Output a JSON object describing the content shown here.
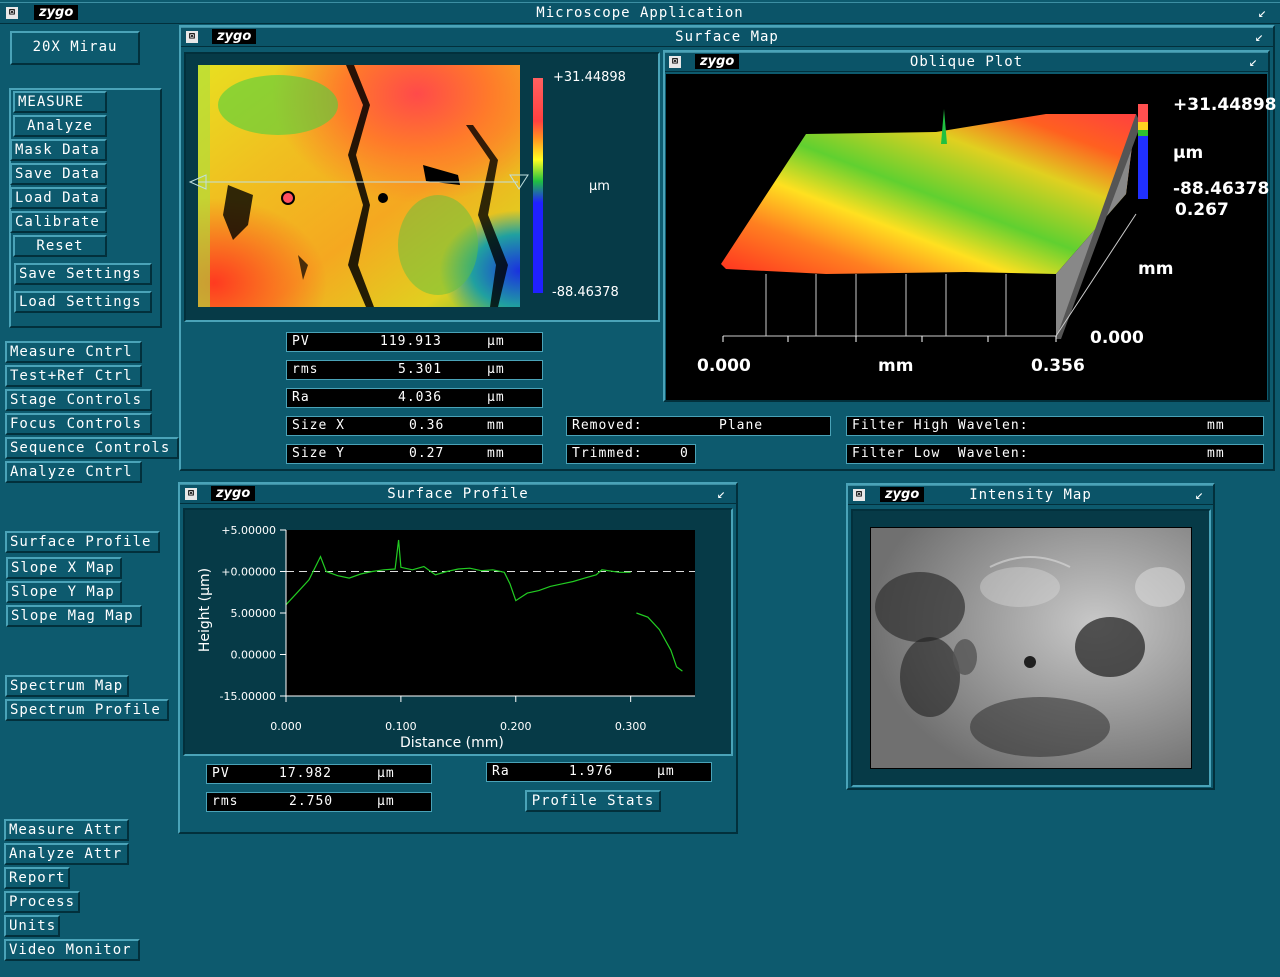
{
  "app": {
    "title": "Microscope  Application",
    "logo": "zygo"
  },
  "objective": "20X  Mirau",
  "left_menu": {
    "measure": "MEASURE",
    "analyze": "Analyze",
    "mask_data": "Mask Data",
    "save_data": "Save Data",
    "load_data": "Load Data",
    "calibrate": "Calibrate",
    "reset": "Reset",
    "save_settings": "Save Settings",
    "load_settings": "Load Settings",
    "measure_cntrl": "Measure Cntrl",
    "test_ref_ctrl": "Test+Ref Ctrl",
    "stage_controls": "Stage Controls",
    "focus_controls": "Focus Controls",
    "sequence_controls": "Sequence Controls",
    "analyze_cntrl": "Analyze Cntrl",
    "surface_profile": "Surface Profile",
    "slope_x_map": "Slope X Map",
    "slope_y_map": "Slope Y Map",
    "slope_mag_map": "Slope Mag Map",
    "spectrum_map": "Spectrum Map",
    "spectrum_profile": "Spectrum Profile",
    "measure_attr": "Measure Attr",
    "analyze_attr": "Analyze Attr",
    "report": "Report",
    "process": "Process",
    "units": "Units",
    "video_monitor": "Video Monitor"
  },
  "surface_map": {
    "title": "Surface Map",
    "scale_max": "+31.44898",
    "scale_min": "-88.46378",
    "scale_unit": "µm",
    "stats": [
      {
        "label": "PV",
        "value": "119.913",
        "unit": "µm"
      },
      {
        "label": "rms",
        "value": "5.301",
        "unit": "µm"
      },
      {
        "label": "Ra",
        "value": "4.036",
        "unit": "µm"
      },
      {
        "label": "Size X",
        "value": "0.36",
        "unit": "mm"
      },
      {
        "label": "Size Y",
        "value": "0.27",
        "unit": "mm"
      }
    ],
    "removed_label": "Removed:",
    "removed_value": "Plane",
    "trimmed_label": "Trimmed:",
    "trimmed_value": "0",
    "filter_high_label": "Filter High Wavelen:",
    "filter_high_unit": "mm",
    "filter_low_label": "Filter Low  Wavelen:",
    "filter_low_unit": "mm"
  },
  "oblique_plot": {
    "title": "Oblique Plot",
    "scale_max": "+31.44898",
    "scale_unit": "µm",
    "scale_min": "-88.46378",
    "y_max": "0.267",
    "y_unit": "mm",
    "y_min": "0.000",
    "x_min": "0.000",
    "x_unit": "mm",
    "x_max": "0.356"
  },
  "surface_profile": {
    "title": "Surface Profile",
    "pv_label": "PV",
    "pv_value": "17.982",
    "pv_unit": "µm",
    "rms_label": "rms",
    "rms_value": "2.750",
    "rms_unit": "µm",
    "ra_label": "Ra",
    "ra_value": "1.976",
    "ra_unit": "µm",
    "stats_button": "Profile Stats"
  },
  "intensity_map": {
    "title": "Intensity Map"
  },
  "chart_data": {
    "type": "line",
    "title": "",
    "xlabel": "Distance (mm)",
    "ylabel": "Height (µm)",
    "xlim": [
      0.0,
      0.356
    ],
    "ylim": [
      -15.0,
      5.0
    ],
    "x_ticks": [
      "0.000",
      "0.100",
      "0.200",
      "0.300"
    ],
    "y_ticks": [
      "+5.00000",
      "+0.00000",
      "5.00000",
      "0.00000",
      "-15.00000"
    ],
    "series": [
      {
        "color": "#22cc22",
        "x": [
          0.0,
          0.01,
          0.02,
          0.03,
          0.035,
          0.045,
          0.055,
          0.065,
          0.075,
          0.085,
          0.095,
          0.098,
          0.1,
          0.11,
          0.12,
          0.13,
          0.14,
          0.15,
          0.16,
          0.17,
          0.18,
          0.19,
          0.195,
          0.2,
          0.21,
          0.22,
          0.23,
          0.24,
          0.25,
          0.26,
          0.27,
          0.275,
          0.29,
          0.3
        ],
        "y": [
          -4.0,
          -2.5,
          -1.0,
          1.8,
          0.0,
          -0.5,
          -0.8,
          -0.3,
          0.0,
          0.2,
          0.3,
          3.8,
          0.5,
          0.2,
          0.6,
          -0.4,
          0.0,
          0.3,
          0.4,
          0.1,
          0.2,
          -0.1,
          -1.5,
          -3.5,
          -2.6,
          -2.3,
          -1.8,
          -1.5,
          -1.2,
          -0.8,
          -0.4,
          0.2,
          -0.1,
          -0.1
        ]
      },
      {
        "color": "#22cc22",
        "x": [
          0.305,
          0.315,
          0.325,
          0.335,
          0.34,
          0.345
        ],
        "y": [
          -5.0,
          -5.5,
          -7.0,
          -9.5,
          -11.5,
          -12.0
        ]
      }
    ],
    "reference_line": 0.0
  }
}
